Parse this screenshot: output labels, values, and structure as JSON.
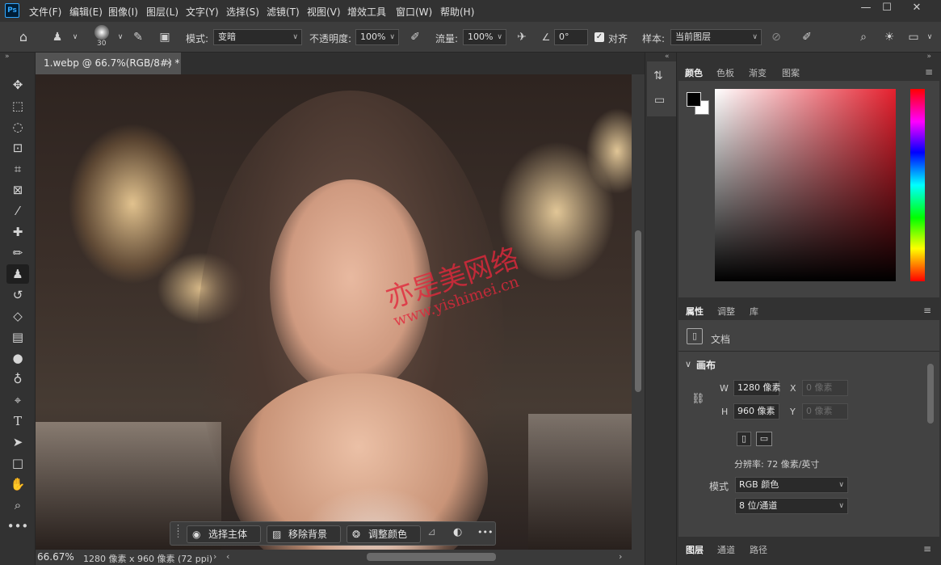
{
  "app": {
    "logo": "Ps"
  },
  "menu": [
    "文件(F)",
    "编辑(E)",
    "图像(I)",
    "图层(L)",
    "文字(Y)",
    "选择(S)",
    "滤镜(T)",
    "视图(V)",
    "增效工具",
    "窗口(W)",
    "帮助(H)"
  ],
  "window_controls": {
    "minimize": "—",
    "maximize": "☐",
    "close": "✕"
  },
  "options": {
    "brush_size": "30",
    "mode_label": "模式:",
    "mode_value": "变暗",
    "opacity_label": "不透明度:",
    "opacity_value": "100%",
    "flow_label": "流量:",
    "flow_value": "100%",
    "angle_value": "0°",
    "align_label": "对齐",
    "sample_label": "样本:",
    "sample_value": "当前图层"
  },
  "document": {
    "tab_title": "1.webp @ 66.7%(RGB/8#) *",
    "close": "×",
    "zoom": "66.67%",
    "dimensions": "1280 像素 x 960 像素 (72 ppi)",
    "watermark_cn": "亦是美网络",
    "watermark_url": "www.yishimei.cn"
  },
  "taskbar": {
    "select_subject": "选择主体",
    "remove_bg": "移除背景",
    "adjust_color": "调整颜色",
    "more": "•••"
  },
  "color_panel": {
    "tabs": [
      "颜色",
      "色板",
      "渐变",
      "图案"
    ],
    "active": "颜色",
    "fg_color": "#000000",
    "bg_color": "#ffffff"
  },
  "properties_panel": {
    "tabs": [
      "属性",
      "调整",
      "库"
    ],
    "type": "文档",
    "section": "画布",
    "w_label": "W",
    "w_value": "1280 像素",
    "h_label": "H",
    "h_value": "960 像素",
    "x_label": "X",
    "x_placeholder": "0 像素",
    "y_label": "Y",
    "y_placeholder": "0 像素",
    "resolution": "分辨率: 72 像素/英寸",
    "mode_label": "模式",
    "mode_value": "RGB 颜色",
    "depth_value": "8 位/通道"
  },
  "layers_panel": {
    "tabs": [
      "图层",
      "通道",
      "路径"
    ]
  }
}
